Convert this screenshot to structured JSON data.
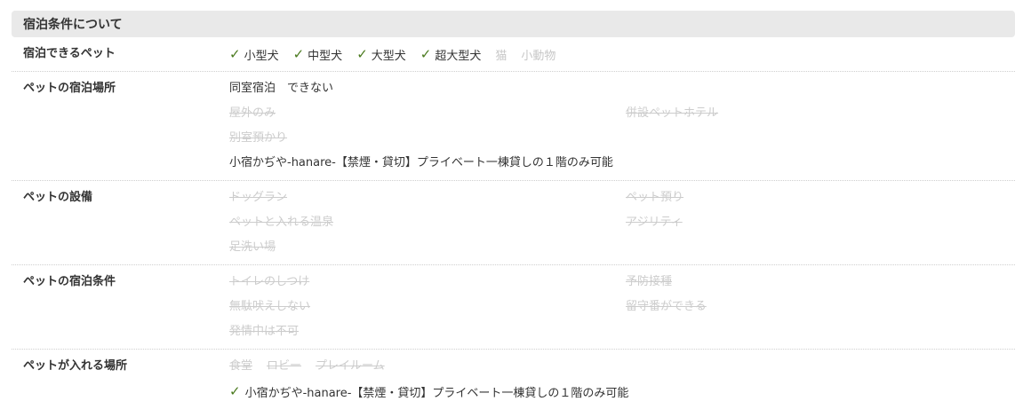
{
  "section_title": "宿泊条件について",
  "rows": {
    "pets": {
      "label": "宿泊できるペット",
      "items": [
        {
          "text": "小型犬",
          "on": true
        },
        {
          "text": "中型犬",
          "on": true
        },
        {
          "text": "大型犬",
          "on": true
        },
        {
          "text": "超大型犬",
          "on": true
        },
        {
          "text": "猫",
          "on": false
        },
        {
          "text": "小動物",
          "on": false
        }
      ]
    },
    "place": {
      "label": "ペットの宿泊場所",
      "main": "同室宿泊　できない",
      "opt1": "屋外のみ",
      "opt2": "併設ペットホテル",
      "opt3": "別室預かり",
      "note": "小宿かぢや-hanare-【禁煙・貸切】プライベート一棟貸しの１階のみ可能"
    },
    "facilities": {
      "label": "ペットの設備",
      "f1": "ドッグラン",
      "f2": "ペット預り",
      "f3": "ペットと入れる温泉",
      "f4": "アジリティ",
      "f5": "足洗い場"
    },
    "conditions": {
      "label": "ペットの宿泊条件",
      "c1": "トイレのしつけ",
      "c2": "予防接種",
      "c3": "無駄吠えしない",
      "c4": "留守番ができる",
      "c5": "発情中は不可"
    },
    "areas": {
      "label": "ペットが入れる場所",
      "a1": "食堂",
      "a2": "ロビー",
      "a3": "プレイルーム",
      "allowed": "小宿かぢや-hanare-【禁煙・貸切】プライベート一棟貸しの１階のみ可能"
    }
  },
  "colors": {
    "check": "#4a7a1e",
    "disabled": "#cccccc",
    "header_bg": "#e9e9e9"
  }
}
